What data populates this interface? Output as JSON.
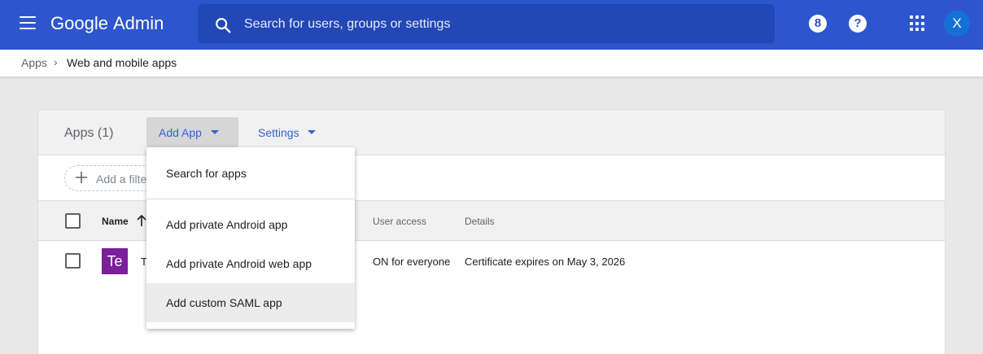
{
  "header": {
    "logo_brand": "Google",
    "logo_product": "Admin",
    "search_placeholder": "Search for users, groups or settings",
    "activity_icon_glyph": "8",
    "help_icon_glyph": "?",
    "avatar_initial": "X",
    "colors": {
      "bar": "#2d55cd",
      "search": "#2347b6",
      "avatar": "#1570d6"
    }
  },
  "breadcrumb": {
    "parent": "Apps",
    "separator": "›",
    "current": "Web and mobile apps"
  },
  "toolbar": {
    "apps_count_label": "Apps (1)",
    "add_app_label": "Add App",
    "settings_label": "Settings"
  },
  "filter": {
    "placeholder": "Add a filter"
  },
  "table": {
    "columns": [
      "Name",
      "User access",
      "Details"
    ],
    "rows": [
      {
        "icon_text": "Te",
        "icon_color": "#7b1f9a",
        "name": "T",
        "user_access": "ON for everyone",
        "details": "Certificate expires on May 3, 2026"
      }
    ]
  },
  "dropdown": {
    "items": [
      {
        "label": "Search for apps"
      },
      {
        "label": "Add private Android app"
      },
      {
        "label": "Add private Android web app"
      },
      {
        "label": "Add custom SAML app"
      }
    ]
  }
}
